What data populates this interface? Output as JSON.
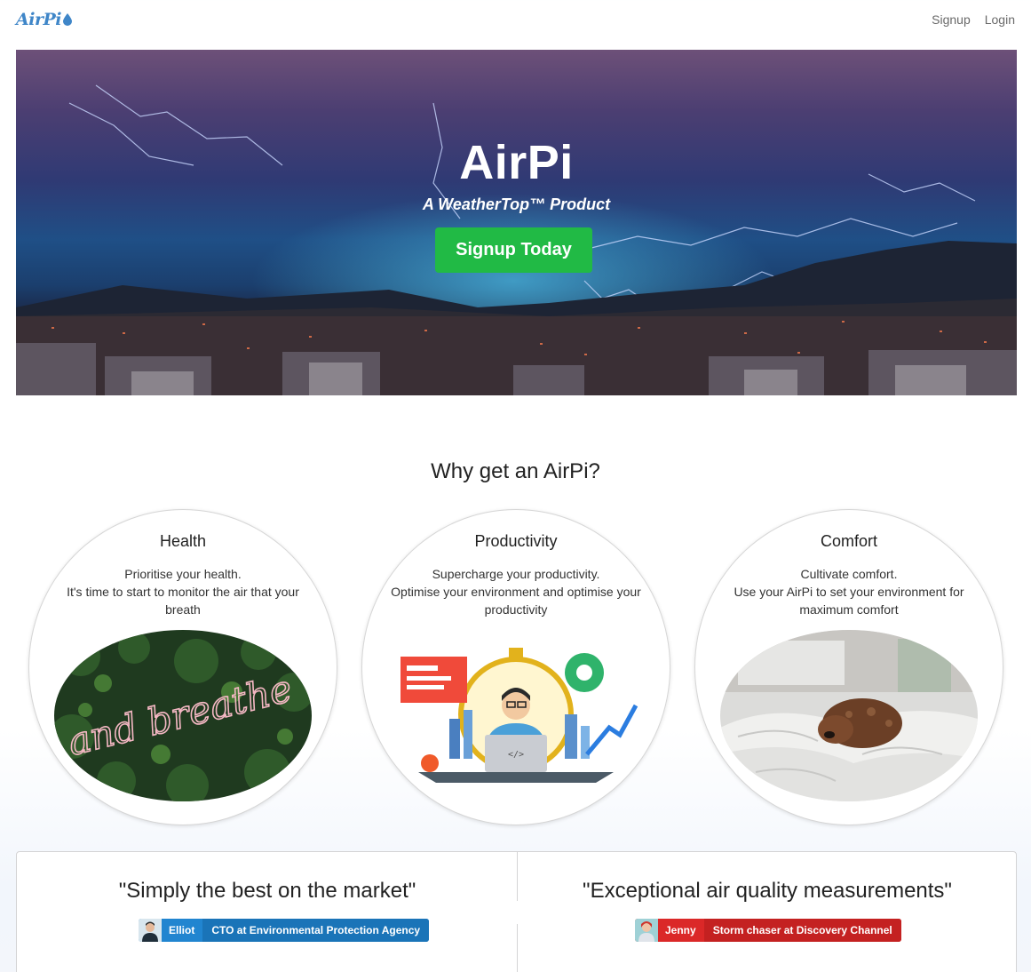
{
  "nav": {
    "logo_text": "AirPi",
    "links": [
      "Signup",
      "Login"
    ]
  },
  "hero": {
    "title": "AirPi",
    "subtitle": "A WeatherTop™ Product",
    "cta_label": "Signup Today"
  },
  "why": {
    "title": "Why get an AirPi?",
    "cards": [
      {
        "title": "Health",
        "line1": "Prioritise your health.",
        "line2": "It's time to start to monitor the air that your breath",
        "image_text": "and breathe"
      },
      {
        "title": "Productivity",
        "line1": "Supercharge your productivity.",
        "line2": "Optimise your environment and optimise your productivity",
        "image_text": "</>"
      },
      {
        "title": "Comfort",
        "line1": "Cultivate comfort.",
        "line2": "Use your AirPi to set your environment for maximum comfort"
      }
    ]
  },
  "testimonials": [
    {
      "quote": "\"Simply the best on the market\"",
      "name": "Elliot",
      "role": "CTO at Environmental Protection Agency",
      "color": "#2185d0"
    },
    {
      "quote": "\"Exceptional air quality measurements\"",
      "name": "Jenny",
      "role": "Storm chaser at Discovery Channel",
      "color": "#db2828"
    }
  ],
  "colors": {
    "brand": "#3f86c8",
    "cta": "#21ba45"
  }
}
